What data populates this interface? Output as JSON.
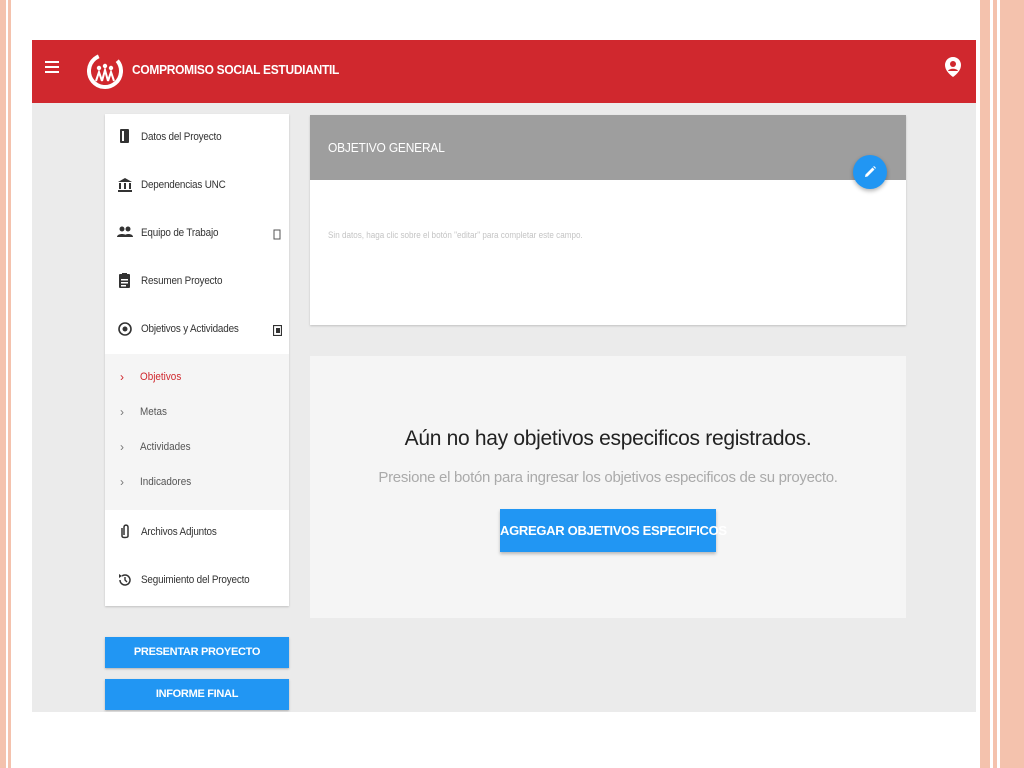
{
  "header": {
    "app_title": "COMPROMISO SOCIAL ESTUDIANTIL",
    "color": "#d0282e"
  },
  "sidebar": {
    "items": [
      {
        "label": "Datos del Proyecto",
        "icon": "book-icon"
      },
      {
        "label": "Dependencias UNC",
        "icon": "institution-icon"
      },
      {
        "label": "Equipo de Trabajo",
        "icon": "people-icon"
      },
      {
        "label": "Resumen Proyecto",
        "icon": "clipboard-icon"
      },
      {
        "label": "Objetivos y Actividades",
        "icon": "radio-target-icon"
      },
      {
        "label": "Archivos Adjuntos",
        "icon": "paperclip-icon"
      },
      {
        "label": "Seguimiento del Proyecto",
        "icon": "history-icon"
      }
    ],
    "sub_items": [
      {
        "label": "Objetivos",
        "active": true
      },
      {
        "label": "Metas",
        "active": false
      },
      {
        "label": "Actividades",
        "active": false
      },
      {
        "label": "Indicadores",
        "active": false
      }
    ],
    "present_button": "PRESENTAR PROYECTO",
    "final_report_button": "INFORME FINAL"
  },
  "objetivo_general": {
    "title": "OBJETIVO GENERAL",
    "empty_message": "Sin datos, haga clic sobre el botón \"editar\" para completar este campo.",
    "edit_icon": "pencil-icon"
  },
  "objetivos_especificos": {
    "empty_title": "Aún no hay objetivos especificos registrados.",
    "empty_subtitle": "Presione el botón para ingresar los objetivos especificos de su proyecto.",
    "add_button": "AGREGAR OBJETIVOS ESPECIFICOS"
  },
  "colors": {
    "primary_red": "#d0282e",
    "accent_blue": "#2196f3",
    "header_grey": "#9e9e9e",
    "slide_accent": "#f4c2ad"
  }
}
